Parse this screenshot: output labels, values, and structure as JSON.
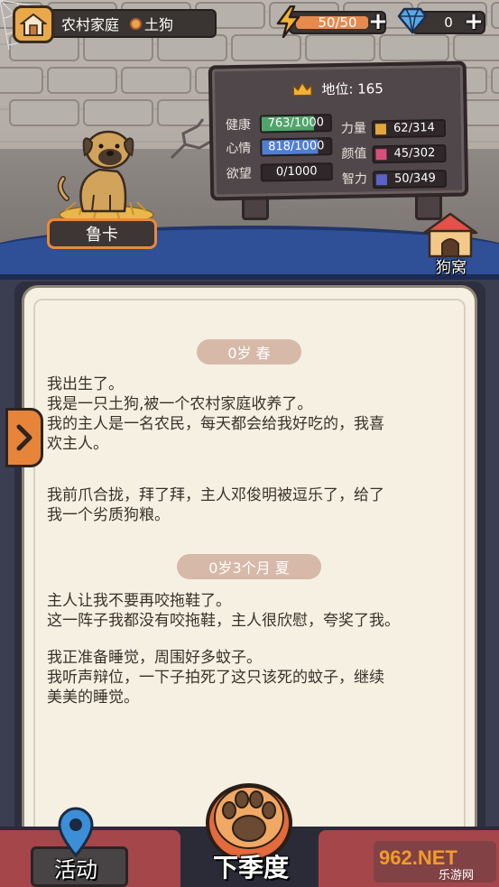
{
  "profile": {
    "family": "农村家庭",
    "breed": "土狗"
  },
  "currency": {
    "energy": "50/50",
    "energy_fraction": 1.0,
    "gems": "0"
  },
  "status": {
    "title": "地位: 165",
    "stats": [
      {
        "label": "健康",
        "value": "763/1000",
        "fraction": 0.763,
        "color": "#4fa56c"
      },
      {
        "label": "心情",
        "value": "818/1000",
        "fraction": 0.818,
        "color": "#4f7fd1"
      },
      {
        "label": "欲望",
        "value": "0/1000",
        "fraction": 0.0,
        "color": "#999999"
      },
      {
        "label": "力量",
        "value": "62/314",
        "fraction": 0.197,
        "color": "#e2a63c"
      },
      {
        "label": "颜值",
        "value": "45/302",
        "fraction": 0.149,
        "color": "#d84f7b"
      },
      {
        "label": "智力",
        "value": "50/349",
        "fraction": 0.143,
        "color": "#5b63c8"
      }
    ]
  },
  "dog": {
    "name": "鲁卡"
  },
  "doghouse": {
    "label": "狗窝"
  },
  "log": {
    "sections": [
      {
        "season": "0岁 春",
        "paragraphs": [
          [
            "我出生了。",
            "我是一只土狗,被一个农村家庭收养了。",
            "我的主人是一名农民，每天都会给我好吃的，我喜",
            "欢主人。"
          ],
          [
            "我前爪合拢，拜了拜，主人邓俊明被逗乐了，给了",
            "我一个劣质狗粮。"
          ]
        ]
      },
      {
        "season": "0岁3个月 夏",
        "paragraphs": [
          [
            "主人让我不要再咬拖鞋了。",
            "这一阵子我都没有咬拖鞋，主人很欣慰，夸奖了我。"
          ],
          [
            "我正准备睡觉，周围好多蚊子。",
            "我听声辩位，一下子拍死了这只该死的蚊子，继续",
            "美美的睡觉。"
          ]
        ]
      }
    ]
  },
  "nav": {
    "activity": "活动",
    "next_season": "下季度"
  },
  "watermark": {
    "brand": "962.NET",
    "sub": "乐游网"
  }
}
